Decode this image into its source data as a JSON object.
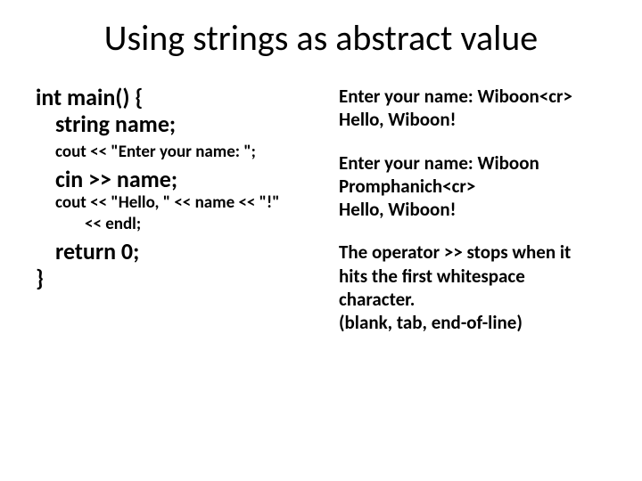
{
  "title": "Using strings as abstract value",
  "code": {
    "l1": "int main() {",
    "l2": "string name;",
    "l3": "cout << \"Enter your name: \";",
    "l4": "cin >> name;",
    "l5": "cout << \"Hello, \" << name << \"!\"",
    "l6": "<< endl;",
    "l7": "return 0;",
    "l8": "}"
  },
  "out": {
    "a1": "Enter your name: Wiboon<cr>",
    "a2": "Hello, Wiboon!",
    "b1": "Enter your name: Wiboon",
    "b2": "Promphanich<cr>",
    "b3": "Hello, Wiboon!",
    "c1": "The operator >> stops when it",
    "c2": "hits the first whitespace",
    "c3": "character.",
    "c4": "(blank, tab, end-of-line)"
  }
}
